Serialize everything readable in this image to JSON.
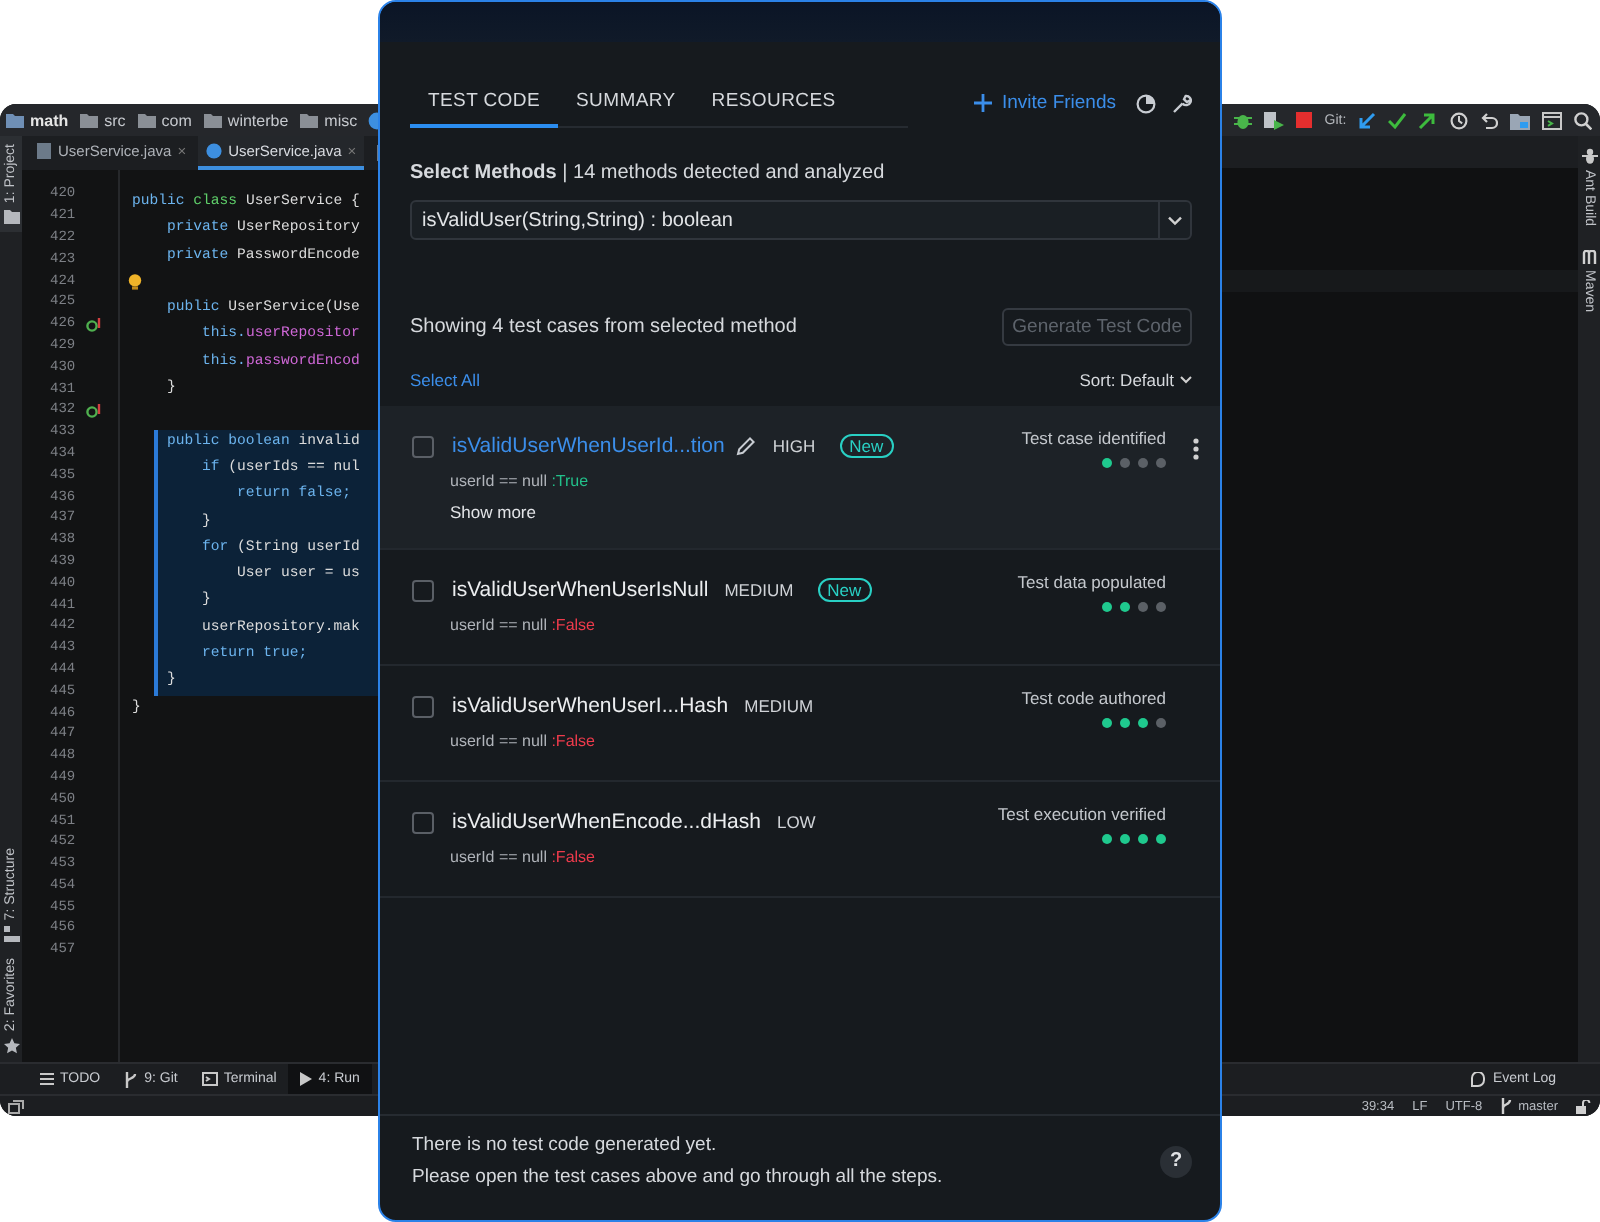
{
  "ide": {
    "breadcrumbs": [
      {
        "label": "math"
      },
      {
        "label": "src"
      },
      {
        "label": "com"
      },
      {
        "label": "winterbe"
      },
      {
        "label": "misc"
      }
    ],
    "tabs": [
      {
        "label": "UserService.java",
        "close": "×",
        "selected": false
      },
      {
        "label": "UserService.java",
        "close": "×",
        "selected": true
      }
    ],
    "left_stripe": [
      {
        "label": "1: Project",
        "kind": "folder",
        "selected": true
      },
      {
        "label": "7: Structure",
        "kind": "structure",
        "selected": false
      },
      {
        "label": "2: Favorites",
        "kind": "star",
        "selected": false
      }
    ],
    "line_numbers": [
      {
        "number": "420",
        "kind": "plain"
      },
      {
        "number": "421",
        "kind": "plain"
      },
      {
        "number": "422",
        "kind": "plain"
      },
      {
        "number": "423",
        "kind": "plain"
      },
      {
        "number": "424",
        "kind": "bulb"
      },
      {
        "number": "425",
        "kind": "plain"
      },
      {
        "number": "426",
        "kind": "override"
      },
      {
        "number": "429",
        "kind": "plain"
      },
      {
        "number": "430",
        "kind": "plain"
      },
      {
        "number": "431",
        "kind": "plain"
      },
      {
        "number": "432",
        "kind": "override"
      },
      {
        "number": "433",
        "kind": "plain"
      },
      {
        "number": "434",
        "kind": "plain"
      },
      {
        "number": "435",
        "kind": "plain"
      },
      {
        "number": "436",
        "kind": "plain"
      },
      {
        "number": "437",
        "kind": "plain"
      },
      {
        "number": "438",
        "kind": "plain"
      },
      {
        "number": "439",
        "kind": "plain"
      },
      {
        "number": "440",
        "kind": "plain"
      },
      {
        "number": "441",
        "kind": "plain"
      },
      {
        "number": "442",
        "kind": "plain"
      },
      {
        "number": "443",
        "kind": "plain"
      },
      {
        "number": "444",
        "kind": "plain"
      },
      {
        "number": "445",
        "kind": "plain"
      },
      {
        "number": "446",
        "kind": "plain"
      },
      {
        "number": "447",
        "kind": "plain"
      },
      {
        "number": "448",
        "kind": "plain"
      },
      {
        "number": "449",
        "kind": "plain"
      },
      {
        "number": "450",
        "kind": "plain"
      },
      {
        "number": "451",
        "kind": "plain"
      },
      {
        "number": "452",
        "kind": "plain"
      },
      {
        "number": "453",
        "kind": "plain"
      },
      {
        "number": "454",
        "kind": "plain"
      },
      {
        "number": "455",
        "kind": "plain"
      },
      {
        "number": "456",
        "kind": "plain"
      },
      {
        "number": "457",
        "kind": "plain"
      }
    ],
    "code": [
      {
        "tokens": [
          {
            "text": "public ",
            "kind": "keyword"
          },
          {
            "text": "class ",
            "kind": "declare"
          },
          {
            "text": "UserService {",
            "kind": "text"
          }
        ]
      },
      {
        "tokens": [
          {
            "text": "    private ",
            "kind": "keyword"
          },
          {
            "text": "UserRepository",
            "kind": "text"
          }
        ]
      },
      {
        "tokens": [
          {
            "text": "    private ",
            "kind": "keyword"
          },
          {
            "text": "PasswordEncode",
            "kind": "text"
          }
        ]
      },
      {
        "space_before": true,
        "tokens": [
          {
            "text": "    public ",
            "kind": "keyword"
          },
          {
            "text": "UserService(Use",
            "kind": "text"
          }
        ]
      },
      {
        "tokens": [
          {
            "text": "        this.",
            "kind": "keyword"
          },
          {
            "text": "userRepositor",
            "kind": "field"
          }
        ]
      },
      {
        "tokens": [
          {
            "text": "        this.",
            "kind": "keyword"
          },
          {
            "text": "passwordEncod",
            "kind": "field"
          }
        ]
      },
      {
        "tokens": [
          {
            "text": "    }",
            "kind": "text"
          }
        ]
      },
      {
        "space_before": true,
        "highlighted": true,
        "tokens": [
          {
            "text": "    public boolean ",
            "kind": "keyword"
          },
          {
            "text": "invalid",
            "kind": "text"
          }
        ]
      },
      {
        "highlighted": true,
        "tokens": [
          {
            "text": "        if ",
            "kind": "keyword"
          },
          {
            "text": "(userIds == nul",
            "kind": "text"
          }
        ]
      },
      {
        "highlighted": true,
        "tokens": [
          {
            "text": "            return false;",
            "kind": "keyword"
          }
        ]
      },
      {
        "highlighted": true,
        "tokens": [
          {
            "text": "        }",
            "kind": "text"
          }
        ]
      },
      {
        "highlighted": true,
        "tokens": [
          {
            "text": "        for ",
            "kind": "keyword"
          },
          {
            "text": "(String userId",
            "kind": "text"
          }
        ]
      },
      {
        "highlighted": true,
        "tokens": [
          {
            "text": "            User user = us",
            "kind": "text"
          }
        ]
      },
      {
        "highlighted": true,
        "tokens": [
          {
            "text": "        }",
            "kind": "text"
          }
        ]
      },
      {
        "highlighted": true,
        "tokens": [
          {
            "text": "        userRepository.mak",
            "kind": "text"
          }
        ]
      },
      {
        "highlighted": true,
        "tokens": [
          {
            "text": "        return true;",
            "kind": "keyword"
          }
        ]
      },
      {
        "highlighted": true,
        "tokens": [
          {
            "text": "    }",
            "kind": "text"
          }
        ]
      },
      {
        "tokens": [
          {
            "text": "}",
            "kind": "text"
          }
        ]
      }
    ],
    "bottom_tools": [
      {
        "label": "TODO",
        "kind": "list",
        "selected": false
      },
      {
        "label": "9: Git",
        "kind": "branch",
        "selected": false
      },
      {
        "label": "Terminal",
        "kind": "terminal",
        "selected": false
      },
      {
        "label": "4: Run",
        "kind": "run",
        "selected": true
      }
    ],
    "git_label": "Git:",
    "right_stripe": [
      {
        "label": "Ant Build",
        "kind": "ant"
      },
      {
        "label": "Maven",
        "kind": "maven"
      }
    ],
    "event_log": "Event Log",
    "status": [
      "39:34",
      "LF",
      "UTF-8"
    ],
    "branch": "master"
  },
  "panel": {
    "tabs": [
      {
        "label": "TEST CODE",
        "selected": true
      },
      {
        "label": "SUMMARY",
        "selected": false
      },
      {
        "label": "RESOURCES",
        "selected": false
      }
    ],
    "invite": "Invite Friends",
    "methods_heading": "**Select Methods**  |  14 methods detected and analyzed",
    "method_select": {
      "value": "isValidUser(String,String) : boolean"
    },
    "summary": "Showing 4 test cases from selected method",
    "generate_button": {
      "label": "Generate Test Code",
      "disabled": true
    },
    "select_all": "Select All",
    "sort": "Sort: Default",
    "test_cases": [
      {
        "name": "isValidUserWhenUserId...tion",
        "selected": true,
        "checked": false,
        "priority": "HIGH",
        "badge": "New",
        "condition": "userId == null",
        "result": ":True",
        "passed": true,
        "show_more": "Show more",
        "step": "Test case identified",
        "stars": 1
      },
      {
        "name": "isValidUserWhenUserIsNull",
        "selected": false,
        "checked": false,
        "priority": "MEDIUM",
        "badge": "New",
        "condition": "userId == null",
        "result": ":False",
        "passed": false,
        "step": "Test data populated",
        "stars": 2
      },
      {
        "name": "isValidUserWhenUserI...Hash",
        "selected": false,
        "checked": false,
        "priority": "MEDIUM",
        "condition": "userId == null",
        "result": ":False",
        "passed": false,
        "step": "Test code authored",
        "stars": 3
      },
      {
        "name": "isValidUserWhenEncode...dHash",
        "selected": false,
        "checked": false,
        "priority": "LOW",
        "condition": "userId == null",
        "result": ":False",
        "passed": false,
        "step": "Test execution verified",
        "stars": 4
      }
    ],
    "footer": [
      "There is no test code generated yet.",
      "Please open the test cases above and go through all the steps."
    ],
    "help": "?"
  }
}
